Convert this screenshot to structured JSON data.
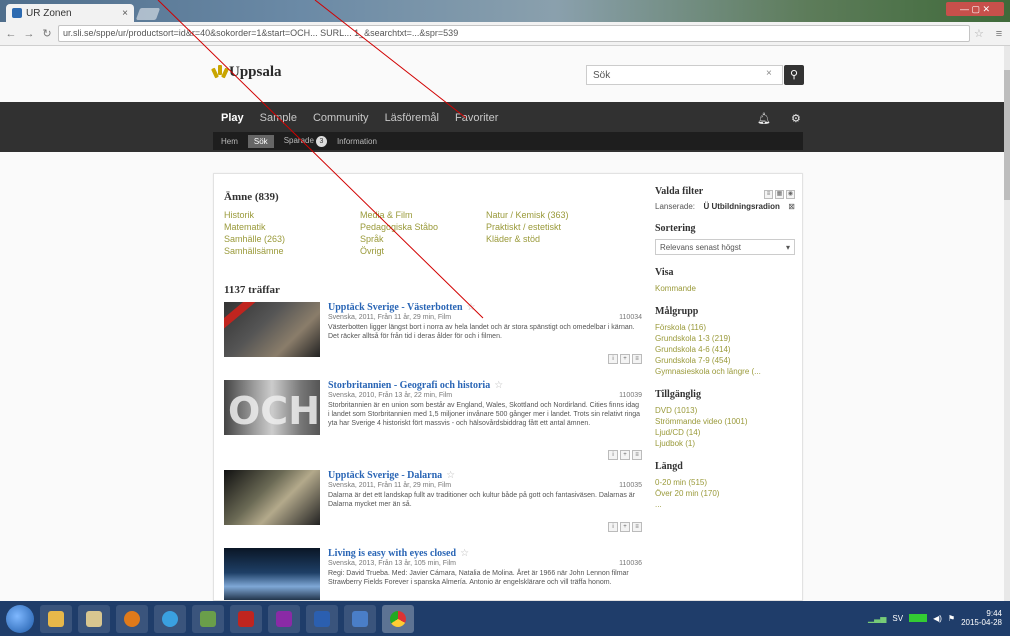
{
  "browser": {
    "tab_title": "UR Zonen",
    "tab_close": "×",
    "window_controls": "— ▢ ✕",
    "url": "ur.sli.se/sppe/ur/productsort=id&r=40&sokorder=1&start=OCH... SURL... 1_&searchtxt=...&spr=539"
  },
  "header": {
    "logo_text": "Uppsala",
    "search_value": "Sök",
    "search_clear": "×"
  },
  "nav": {
    "main": [
      "Play",
      "Sample",
      "Community",
      "Läsföremål",
      "Favoriter"
    ],
    "sub": [
      "Hem",
      "Sök",
      "Sparade",
      "Information"
    ],
    "sparade_count": "3"
  },
  "amne": {
    "title": "Ämne (839)",
    "items": [
      "Historik",
      "Media & Film",
      "Natur / Kemisk (363)",
      "Matematik",
      "Pedagogiska Ståbo",
      "Praktiskt / estetiskt",
      "Samhälle (263)",
      "Språk",
      "Kläder & stöd",
      "Samhällsämne",
      "Övrigt",
      ""
    ]
  },
  "results": {
    "hits_title": "1137 träffar",
    "items": [
      {
        "title": "Upptäck Sverige - Västerbotten",
        "meta": "Svenska, 2011, Från 11 år, 29 min, Film",
        "kod": "110034",
        "desc": "Västerbotten ligger längst bort i norra av hela landet och är stora spänstigt och omedelbar i kärnan. Det räcker alltså för från tid i deras ålder för och i filmen."
      },
      {
        "title": "Storbritannien - Geografi och historia",
        "meta": "Svenska, 2010, Från 13 år, 22 min, Film",
        "kod": "110039",
        "desc": "Storbritannien är en union som består av England, Wales, Skottland och Nordirland. Cities finns idag i landet som Storbritannien med 1,5 miljoner invånare 500 gånger mer i landet. Trots sin relativt ringa yta har Sverige 4 historiskt fört massvis - och hälsovårdsbiddrag fått ett antal ämnen."
      },
      {
        "title": "Upptäck Sverige - Dalarna",
        "meta": "Svenska, 2011, Från 11 år, 29 min, Film",
        "kod": "110035",
        "desc": "Dalarna är det ett landskap fullt av traditioner och kultur både på gott och fantasiväsen. Dalarnas är Dalarna mycket mer än så."
      },
      {
        "title": "Living is easy with eyes closed",
        "meta": "Svenska, 2013, Från 13 år, 105 min, Film",
        "kod": "110036",
        "desc": "Regi: David Trueba. Med: Javier Cámara, Natalia de Molina. Året är 1966 när John Lennon filmar Strawberry Fields Forever i spanska Almería. Antonio är engelsklärare och vill träffa honom."
      }
    ]
  },
  "sidebar": {
    "filter_title": "Valda filter",
    "filter_label": "Lanserade:",
    "filter_value": "Ü Utbildningsradion",
    "sort_title": "Sortering",
    "sort_value": "Relevans senast högst",
    "visa_title": "Visa",
    "visa_items": [
      "Kommande"
    ],
    "mal_title": "Målgrupp",
    "mal_items": [
      "Förskola (116)",
      "Grundskola 1-3 (219)",
      "Grundskola 4-6 (414)",
      "Grundskola 7-9 (454)",
      "Gymnasieskola och längre (..."
    ],
    "tillg_title": "Tillgänglig",
    "tillg_items": [
      "DVD (1013)",
      "Strömmande video (1001)",
      "Ljud/CD (14)",
      "Ljudbok (1)"
    ],
    "langd_title": "Längd",
    "langd_items": [
      "0-20 min (515)",
      "Över 20 min (170)",
      "..."
    ]
  },
  "taskbar": {
    "clock_time": "9:44",
    "clock_date": "2015-04-28",
    "lang": "SV"
  },
  "colors": {
    "annotation": "#d10000",
    "nav_bg": "#313131",
    "link_title": "#2965b5",
    "facet_link": "#9a9a3a"
  }
}
